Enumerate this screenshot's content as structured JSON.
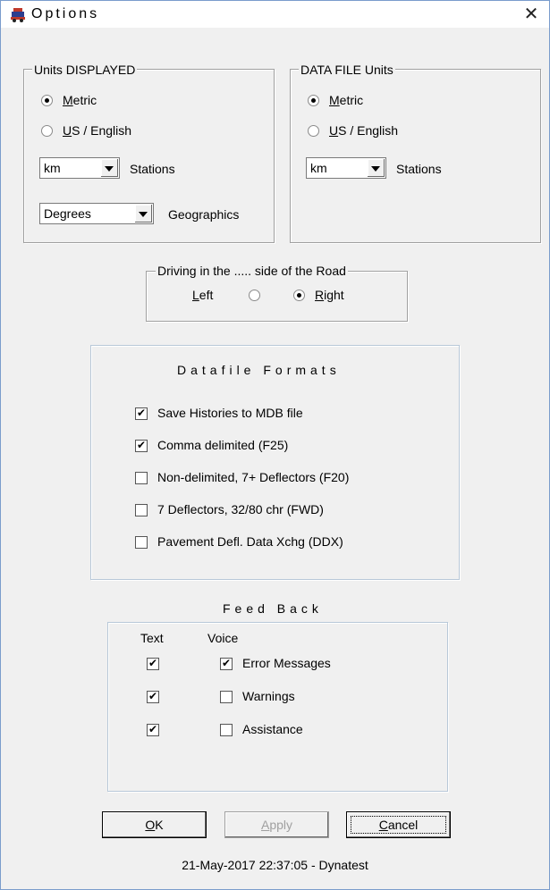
{
  "window": {
    "title": "Options",
    "close_glyph": "✕"
  },
  "units_displayed": {
    "legend": "Units DISPLAYED",
    "metric_label": "Metric",
    "us_label": "US / English",
    "selected": "Metric",
    "stations_value": "km",
    "stations_label": "Stations",
    "geographics_value": "Degrees",
    "geographics_label": "Geographics"
  },
  "data_file_units": {
    "legend": "DATA FILE Units",
    "metric_label": "Metric",
    "us_label": "US / English",
    "selected": "Metric",
    "stations_value": "km",
    "stations_label": "Stations"
  },
  "driving_side": {
    "legend": "Driving in the ..... side of the Road",
    "left_label": "Left",
    "right_label": "Right",
    "selected": "Right"
  },
  "datafile_formats": {
    "title": "Datafile Formats",
    "items": [
      {
        "label": "Save Histories to MDB file",
        "checked": true
      },
      {
        "label": "Comma delimited (F25)",
        "checked": true
      },
      {
        "label": "Non-delimited, 7+ Deflectors (F20)",
        "checked": false
      },
      {
        "label": "7 Deflectors, 32/80 chr (FWD)",
        "checked": false
      },
      {
        "label": "Pavement Defl. Data Xchg (DDX)",
        "checked": false
      }
    ]
  },
  "feedback": {
    "title": "Feed Back",
    "text_header": "Text",
    "voice_header": "Voice",
    "rows": [
      {
        "label": "Error Messages",
        "text": true,
        "voice": true
      },
      {
        "label": "Warnings",
        "text": true,
        "voice": false
      },
      {
        "label": "Assistance",
        "text": true,
        "voice": false
      }
    ]
  },
  "buttons": {
    "ok": "OK",
    "apply": "Apply",
    "cancel": "Cancel"
  },
  "status": "21-May-2017 22:37:05 - Dynatest"
}
